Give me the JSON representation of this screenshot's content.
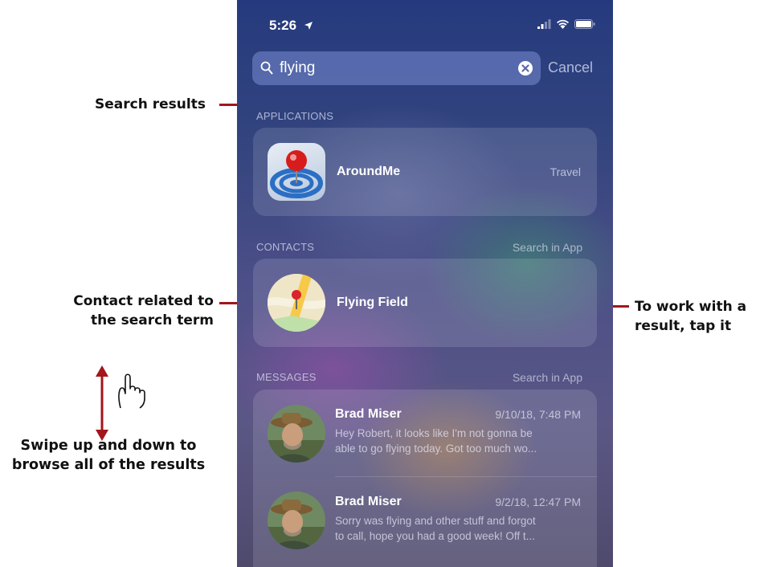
{
  "callouts": {
    "search_results": "Search results",
    "contact_line1": "Contact related to",
    "contact_line2": "the search term",
    "tap_line1": "To work with a",
    "tap_line2": "result, tap it",
    "swipe_line1": "Swipe up and down to",
    "swipe_line2": "browse all of the results",
    "callout_color": "#a3161b"
  },
  "status_bar": {
    "time": "5:26",
    "location_icon": "location-arrow-icon",
    "signal_icon": "signal-icon",
    "wifi_icon": "wifi-icon",
    "battery_icon": "battery-icon"
  },
  "search": {
    "value": "flying",
    "cancel_label": "Cancel"
  },
  "applications": {
    "header": "APPLICATIONS",
    "items": [
      {
        "name": "AroundMe",
        "category": "Travel",
        "icon": "aroundme-app-icon"
      }
    ]
  },
  "contacts": {
    "header": "CONTACTS",
    "search_in_app": "Search in App",
    "items": [
      {
        "name": "Flying Field",
        "icon": "map-pin-avatar"
      }
    ]
  },
  "messages": {
    "header": "MESSAGES",
    "search_in_app": "Search in App",
    "items": [
      {
        "sender": "Brad Miser",
        "date": "9/10/18, 7:48 PM",
        "line1": "Hey Robert, it looks like I'm not gonna be",
        "line2": "able to go flying today. Got too much wo..."
      },
      {
        "sender": "Brad Miser",
        "date": "9/2/18, 12:47 PM",
        "line1": "Sorry was flying and other stuff and forgot",
        "line2": "to call, hope you had a good week! Off t..."
      }
    ]
  }
}
